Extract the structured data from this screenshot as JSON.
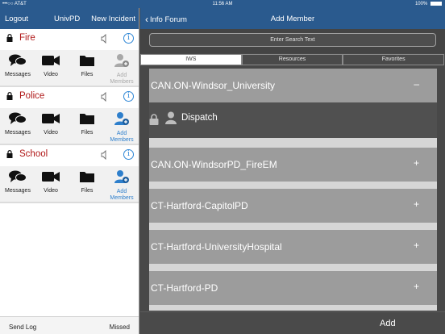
{
  "status_bar": {
    "carrier": "•••○○ AT&T",
    "time": "11:56 AM",
    "battery": "100%"
  },
  "left_nav": {
    "logout": "Logout",
    "title": "UnivPD",
    "new_incident": "New Incident"
  },
  "channels": [
    {
      "name": "Fire",
      "actions": {
        "messages": "Messages",
        "video": "Video",
        "files": "Files",
        "add_members_line1": "Add",
        "add_members_line2": "Members"
      },
      "add_members_enabled": false
    },
    {
      "name": "Police",
      "actions": {
        "messages": "Messages",
        "video": "Video",
        "files": "Files",
        "add_members_line1": "Add",
        "add_members_line2": "Members"
      },
      "add_members_enabled": true
    },
    {
      "name": "School",
      "actions": {
        "messages": "Messages",
        "video": "Video",
        "files": "Files",
        "add_members_line1": "Add",
        "add_members_line2": "Members"
      },
      "add_members_enabled": true
    }
  ],
  "left_footer": {
    "send_log": "Send Log",
    "missed": "Missed"
  },
  "right_nav": {
    "back": "Info Forum",
    "title": "Add Member"
  },
  "search": {
    "placeholder": "Enter Search Text"
  },
  "tabs": [
    {
      "label": "IWS",
      "selected": true
    },
    {
      "label": "Resources",
      "selected": false
    },
    {
      "label": "Favorites",
      "selected": false
    }
  ],
  "groups": [
    {
      "name": "CAN.ON-Windsor_University",
      "toggle": "–",
      "expanded": true,
      "members": [
        {
          "name": "Dispatch"
        }
      ]
    },
    {
      "name": "CAN.ON-WindsorPD_FireEM",
      "toggle": "+"
    },
    {
      "name": "CT-Hartford-CapitolPD",
      "toggle": "+"
    },
    {
      "name": "CT-Hartford-UniversityHospital",
      "toggle": "+"
    },
    {
      "name": "CT-Hartford-PD",
      "toggle": "+"
    }
  ],
  "right_footer": {
    "add": "Add"
  },
  "colors": {
    "nav_blue": "#2a5a8e",
    "channel_red": "#b01818",
    "link_blue": "#2e86d6"
  }
}
